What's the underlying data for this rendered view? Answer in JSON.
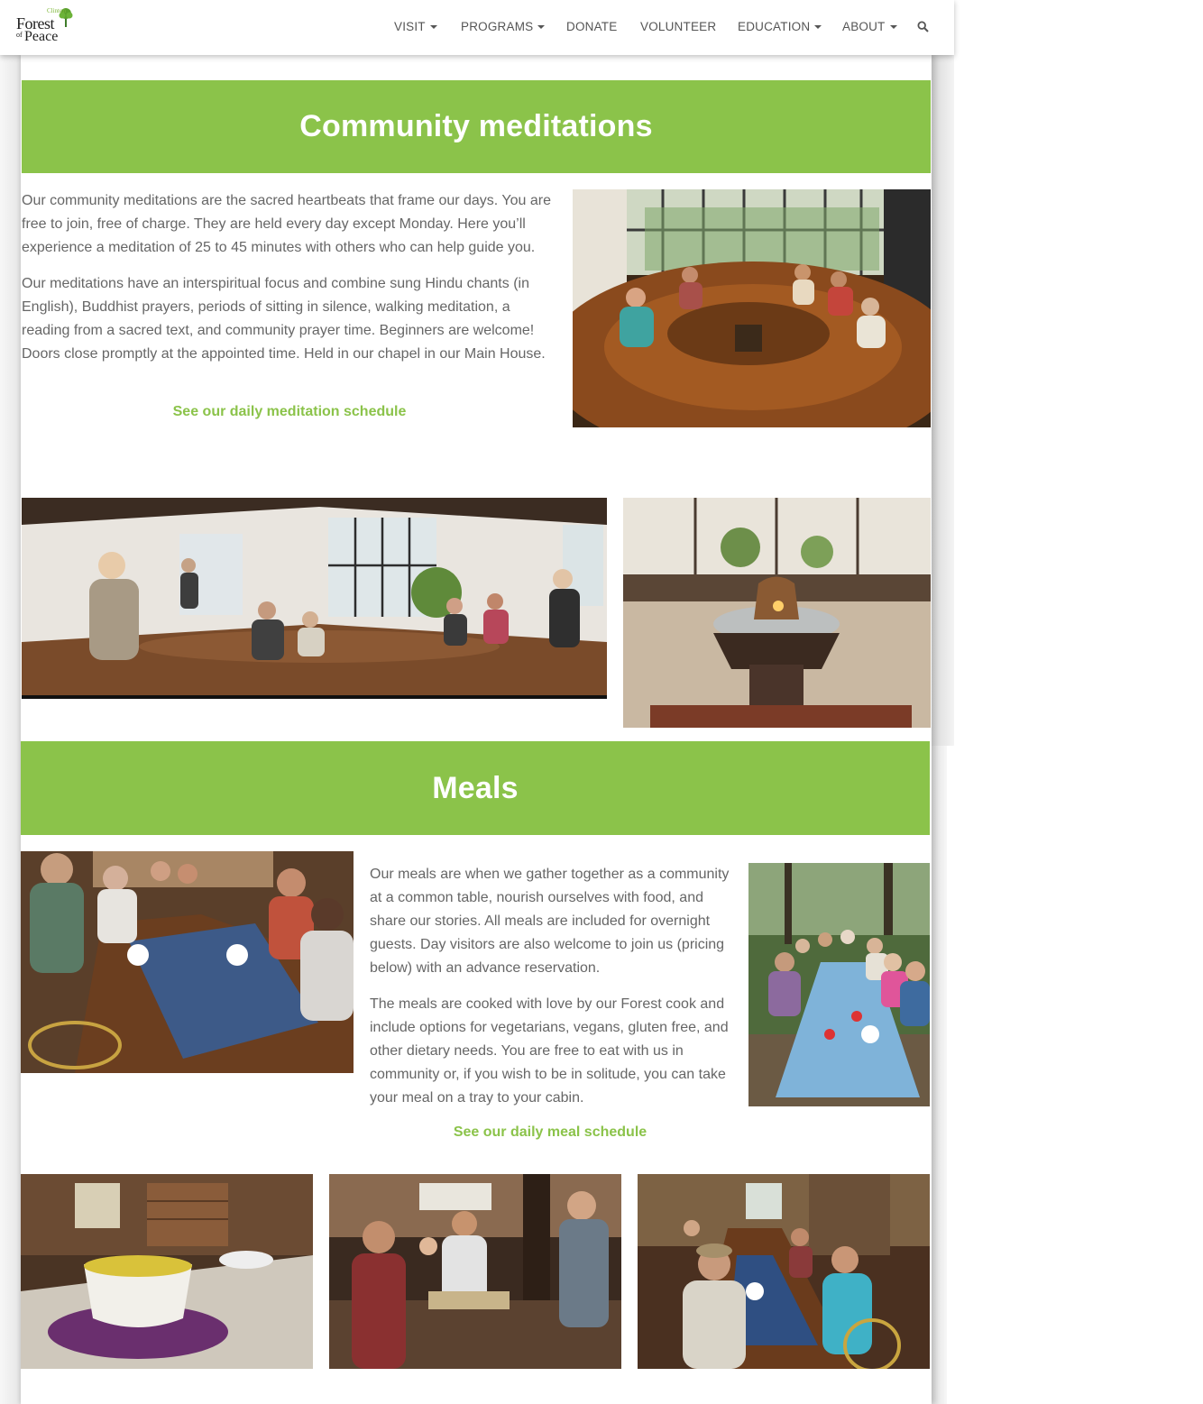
{
  "site": {
    "logo": {
      "small": "Clinton",
      "forest": "Forest",
      "of": "of",
      "peace": "Peace"
    }
  },
  "nav": {
    "items": [
      {
        "label": "VISIT",
        "dropdown": true
      },
      {
        "label": "PROGRAMS",
        "dropdown": true
      },
      {
        "label": "DONATE",
        "dropdown": false
      },
      {
        "label": "VOLUNTEER",
        "dropdown": false
      },
      {
        "label": "EDUCATION",
        "dropdown": true
      },
      {
        "label": "ABOUT",
        "dropdown": true
      }
    ],
    "search_icon": "search-icon"
  },
  "meditations": {
    "title": "Community meditations",
    "paragraphs": [
      "Our community meditations are the sacred heartbeats that frame our days. You are free to join, free of charge. They are held every day except Monday. Here you’ll experience a meditation of 25 to 45 minutes with others who can help guide you.",
      "Our meditations have an interspiritual focus and combine sung Hindu chants (in English), Buddhist prayers, periods of sitting in silence, walking meditation, a reading from a sacred text, and community prayer time. Beginners are welcome! Doors close promptly at the appointed time. Held in our chapel in our Main House."
    ],
    "link": "See our daily meditation schedule"
  },
  "meals": {
    "title": "Meals",
    "paragraphs": [
      "Our meals are when we gather together as a community at a common table, nourish ourselves with food, and share our stories. All meals are included for overnight guests. Day visitors are also welcome to join us (pricing below) with an advance reservation.",
      "The meals are cooked with love by our Forest cook and include options for vegetarians, vegans, gluten free, and other dietary needs. You are free to eat with us in community or, if you wish to be in solitude, you can take your meal on a tray to your cabin."
    ],
    "link": "See our daily meal schedule"
  },
  "colors": {
    "accent": "#8bc34a",
    "text": "#666666",
    "nav_text": "#555555"
  }
}
